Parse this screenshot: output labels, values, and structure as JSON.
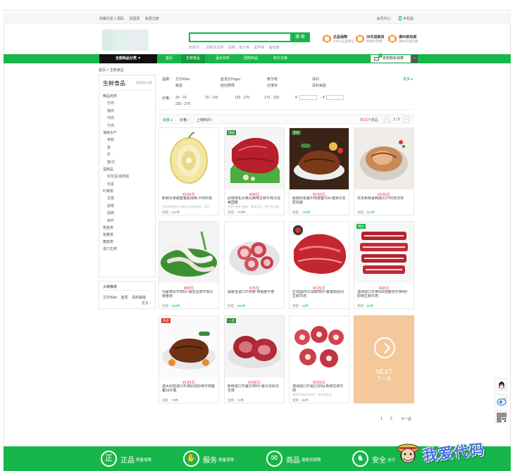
{
  "topbar": {
    "left": [
      "收藏外星人源码",
      "请登录",
      "免费注册"
    ],
    "member": "会员中心",
    "mobile": "手机版"
  },
  "search": {
    "placeholder": "",
    "button": "搜 索",
    "hot_label": "热搜词：",
    "hot_words": [
      "雪糕冰淇淋",
      "蛋糕，蜜沙棒",
      "黑芦荟",
      "面包蟹"
    ]
  },
  "guarantees": [
    {
      "title": "正品保障",
      "sub": "100%正品保证",
      "color": "#f3a24d"
    },
    {
      "title": "30天退换货",
      "sub": "购物有保障",
      "color": "#f3a24d"
    },
    {
      "title": "满99就包邮",
      "sub": "满99元就包邮",
      "color": "#f3a24d"
    }
  ],
  "nav": {
    "all_categories": "全部商品分类 ▼",
    "items": [
      "首页",
      "生鲜食品",
      "酒水饮料",
      "团购商品",
      "积分兑换"
    ],
    "active_index": 1,
    "cart_count": "0",
    "cart_label": "去购物车结算",
    "cart_arrow": "›"
  },
  "breadcrumb": "首页 > 生鲜食品",
  "sidebar": {
    "title": "生鲜食品",
    "count": "商品共13件",
    "categories": [
      {
        "name": "精品肉类",
        "subs": [
          "羊肉",
          "猪肉",
          "鸡肉",
          "牛肉"
        ]
      },
      {
        "name": "海鲜水产",
        "subs": [
          "参鲍",
          "鱼",
          "虾",
          "蟹/贝"
        ]
      },
      {
        "name": "蛋制品",
        "subs": [
          "松花蛋/咸鸭蛋",
          "鸡蛋"
        ]
      },
      {
        "name": "叶菜类",
        "subs": [
          "生菜",
          "菠菜",
          "圆椒",
          "西芹"
        ]
      },
      {
        "name": "根茎类",
        "subs": []
      },
      {
        "name": "茄果类",
        "subs": []
      },
      {
        "name": "菌菇类",
        "subs": []
      },
      {
        "name": "进口生鲜",
        "subs": []
      }
    ]
  },
  "hot_brands": {
    "title": "大牌推荐",
    "brands": [
      "艾尔Wier",
      "金发",
      "百利来能"
    ],
    "more": "更多 ›"
  },
  "filter": {
    "brand_label": "品牌：",
    "brands": [
      "艾尔Wier",
      "金发达Hager",
      "奢华佬",
      "百利",
      "森蓝",
      "能创质啊",
      "达博米",
      "百利来能"
    ],
    "more": "更多 ▾",
    "price_label": "价格：",
    "prices": [
      "20 - 70",
      "70 - 120",
      "120 - 170",
      "170 - 220",
      "220 - 270"
    ],
    "price_from": "¥",
    "price_to": "- ¥"
  },
  "sortbar": {
    "sorts": [
      "销量",
      "价格",
      "上架时间"
    ],
    "total_prefix": "共",
    "total_count": "13",
    "total_suffix": "个商品",
    "page": "1 / 2",
    "prev": "‹",
    "next": "›"
  },
  "products": [
    {
      "price": "¥156元",
      "name": "新鲜水果甜蜜香甜滑果汁5000克",
      "desc": "金耳原装果汁口感比市面滑新鲜，减少",
      "sales_label": "销量：",
      "sales": "141件",
      "img": "melon",
      "tag": ""
    },
    {
      "price": "¥88元",
      "name": "原味有机大黄瓜美味生鲜牛肉冷冻美国麦",
      "desc": "纯营+佰原+细腻，原味自然，原生态山坡",
      "sales_label": "销量：",
      "sales": "743件",
      "img": "beef1",
      "tag": "田园"
    },
    {
      "price": "¥238元",
      "name": "新鲜原包装牛肉排套10片澳洲冷冻原包装",
      "desc": "",
      "sales_label": "销量：",
      "sales": "743件",
      "img": "steak",
      "tag": "新鲜"
    },
    {
      "price": "¥108元",
      "name": "日本新鲜豪蚝扇贝2700克日本",
      "desc": "",
      "sales_label": "销量：",
      "sales": "524件",
      "img": "scallop",
      "tag": ""
    },
    {
      "price": "¥88元",
      "name": "内蒙草原牛肉5斤速冻生鲜牛肉火锅食材",
      "desc": "",
      "sales_label": "销量：",
      "sales": "349件",
      "img": "tripe",
      "tag": ""
    },
    {
      "price": "¥75元",
      "name": "极致全进口牛肉卷 特级肥牛卷",
      "desc": "",
      "sales_label": "销量：",
      "sales": "256件",
      "img": "rolls",
      "tag": ""
    },
    {
      "price": "¥125元",
      "name": "正宗国内冷冻鲜肉5斤装澳洲谷饲生鲜牛肉",
      "desc": "",
      "sales_label": "销量：",
      "sales": "64件",
      "img": "beef2",
      "tag": ""
    },
    {
      "price": "¥28元",
      "name": "澳洲进口牛排500克整切牛排4份原味生鲜牛肉",
      "desc": "",
      "sales_label": "销量：",
      "sales": "64件",
      "img": "ribs",
      "tag": "特价"
    },
    {
      "price": "¥199元",
      "name": "澳大利亚进口牛排原切原味牛肉套餐10片装",
      "desc": "",
      "sales_label": "销量：",
      "sales": "79件",
      "img": "steak2",
      "tag": "热卖"
    },
    {
      "price": "¥168元",
      "name": "新鲜进口牛腱子肉5斤装冷冻原切生鲜",
      "desc": "",
      "sales_label": "销量：",
      "sales": "74件",
      "img": "shank",
      "tag": "一览"
    },
    {
      "price": "¥255元",
      "name": "澳洲进口牛尾巴200g 新鲜生鲜牛肉",
      "desc": "新鲜牛尾肉质丰厚，原生态牧场",
      "sales_label": "销量：",
      "sales": "82件",
      "img": "oxtail",
      "tag": ""
    }
  ],
  "next_card": {
    "en": "NEXT",
    "cn": "下一页"
  },
  "pagination": {
    "p1": "1",
    "p2": "2",
    "next": "下一页"
  },
  "footer": [
    {
      "icon": "正",
      "big": "正品",
      "small": "质量保障"
    },
    {
      "icon": "✋",
      "big": "服务",
      "small": "质量保障"
    },
    {
      "icon": "✉",
      "big": "商品",
      "small": "退换货保障"
    },
    {
      "icon": "♞",
      "big": "安全",
      "small": "支付"
    }
  ],
  "watermark": "我爱代码"
}
